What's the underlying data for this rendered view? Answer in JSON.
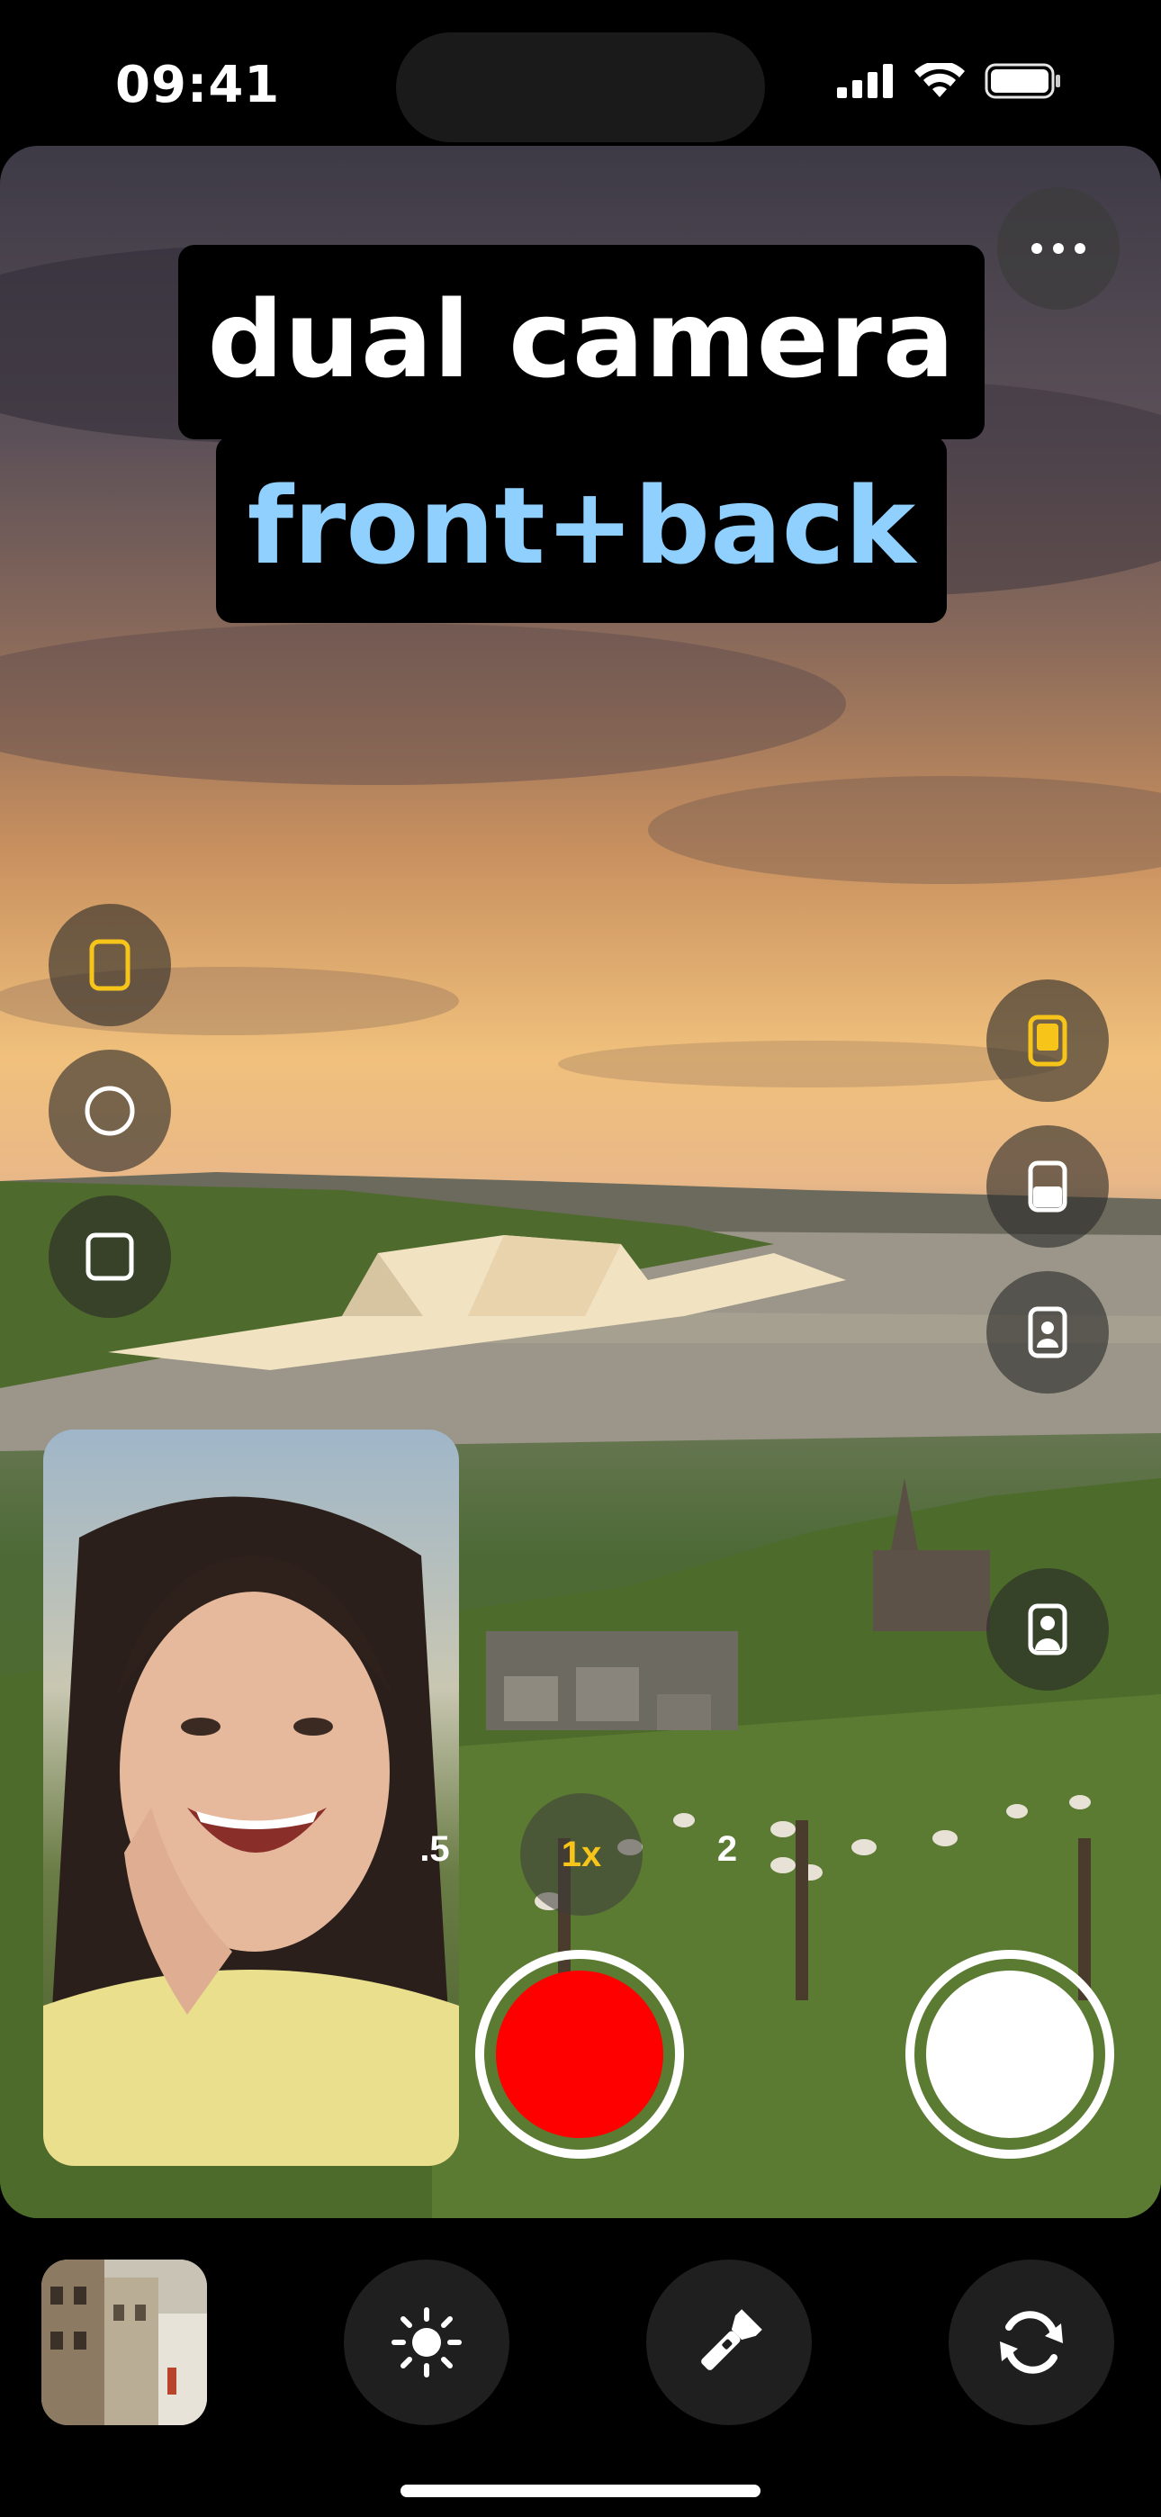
{
  "status_bar": {
    "time": "09:41"
  },
  "title": {
    "line1": "dual camera",
    "line2": "front+back"
  },
  "colors": {
    "accent_yellow": "#f7c51a",
    "title_blue": "#8fd0ff",
    "record_red": "#ff0000"
  },
  "left_controls": [
    {
      "icon": "rounded-rect-icon",
      "selected": true
    },
    {
      "icon": "circle-icon",
      "selected": false
    },
    {
      "icon": "square-icon",
      "selected": false
    }
  ],
  "right_controls": [
    {
      "icon": "layout-pip-icon",
      "selected": true
    },
    {
      "icon": "layout-split-icon",
      "selected": false
    },
    {
      "icon": "layout-portrait-frame-icon",
      "selected": false
    },
    {
      "icon": "layout-portrait-full-icon",
      "selected": false
    }
  ],
  "zoom": {
    "options": [
      ".5",
      "1x",
      "2"
    ],
    "selected": "1x"
  },
  "toolbar": {
    "icons": [
      "gallery-thumbnail",
      "brightness-icon",
      "flashlight-icon",
      "switch-camera-icon"
    ]
  }
}
